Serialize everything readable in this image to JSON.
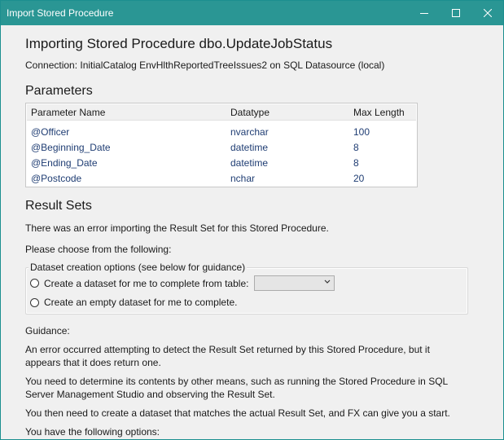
{
  "window": {
    "title": "Import Stored Procedure",
    "controls": {
      "minimize_icon": "minimize-icon",
      "maximize_icon": "maximize-icon",
      "close_icon": "close-icon"
    }
  },
  "heading": "Importing Stored Procedure dbo.UpdateJobStatus",
  "connection": "Connection: InitialCatalog  EnvHlthReportedTreeIssues2  on SQL Datasource  (local)",
  "parameters": {
    "title": "Parameters",
    "columns": [
      "Parameter Name",
      "Datatype",
      "Max Length"
    ],
    "rows": [
      {
        "name": "@Officer",
        "type": "nvarchar",
        "len": "100"
      },
      {
        "name": "@Beginning_Date",
        "type": "datetime",
        "len": "8"
      },
      {
        "name": "@Ending_Date",
        "type": "datetime",
        "len": "8"
      },
      {
        "name": "@Postcode",
        "type": "nchar",
        "len": "20"
      }
    ]
  },
  "result_sets": {
    "title": "Result Sets",
    "error": "There was an error importing the Result Set for this Stored Procedure.",
    "choose": "Please choose from the following:",
    "group_legend": "Dataset creation options (see below for guidance)",
    "option_table": "Create a dataset for me to complete from table:",
    "table_combo_value": "",
    "option_empty": "Create an empty dataset for me to complete."
  },
  "guidance": {
    "label": "Guidance:",
    "p1": "An error occurred attempting to detect the Result Set returned by this Stored Procedure, but it appears that it does return one.",
    "p2": "You need to determine its contents by other means, such as running the Stored Procedure in SQL Server Management Studio and observing the Result Set.",
    "p3": "You then need to create a dataset that matches the actual Result Set, and FX can give you a start.",
    "p4": "You have the following options:"
  },
  "colors": {
    "titlebar": "#2a9694",
    "row_text": "#1f3d73"
  }
}
